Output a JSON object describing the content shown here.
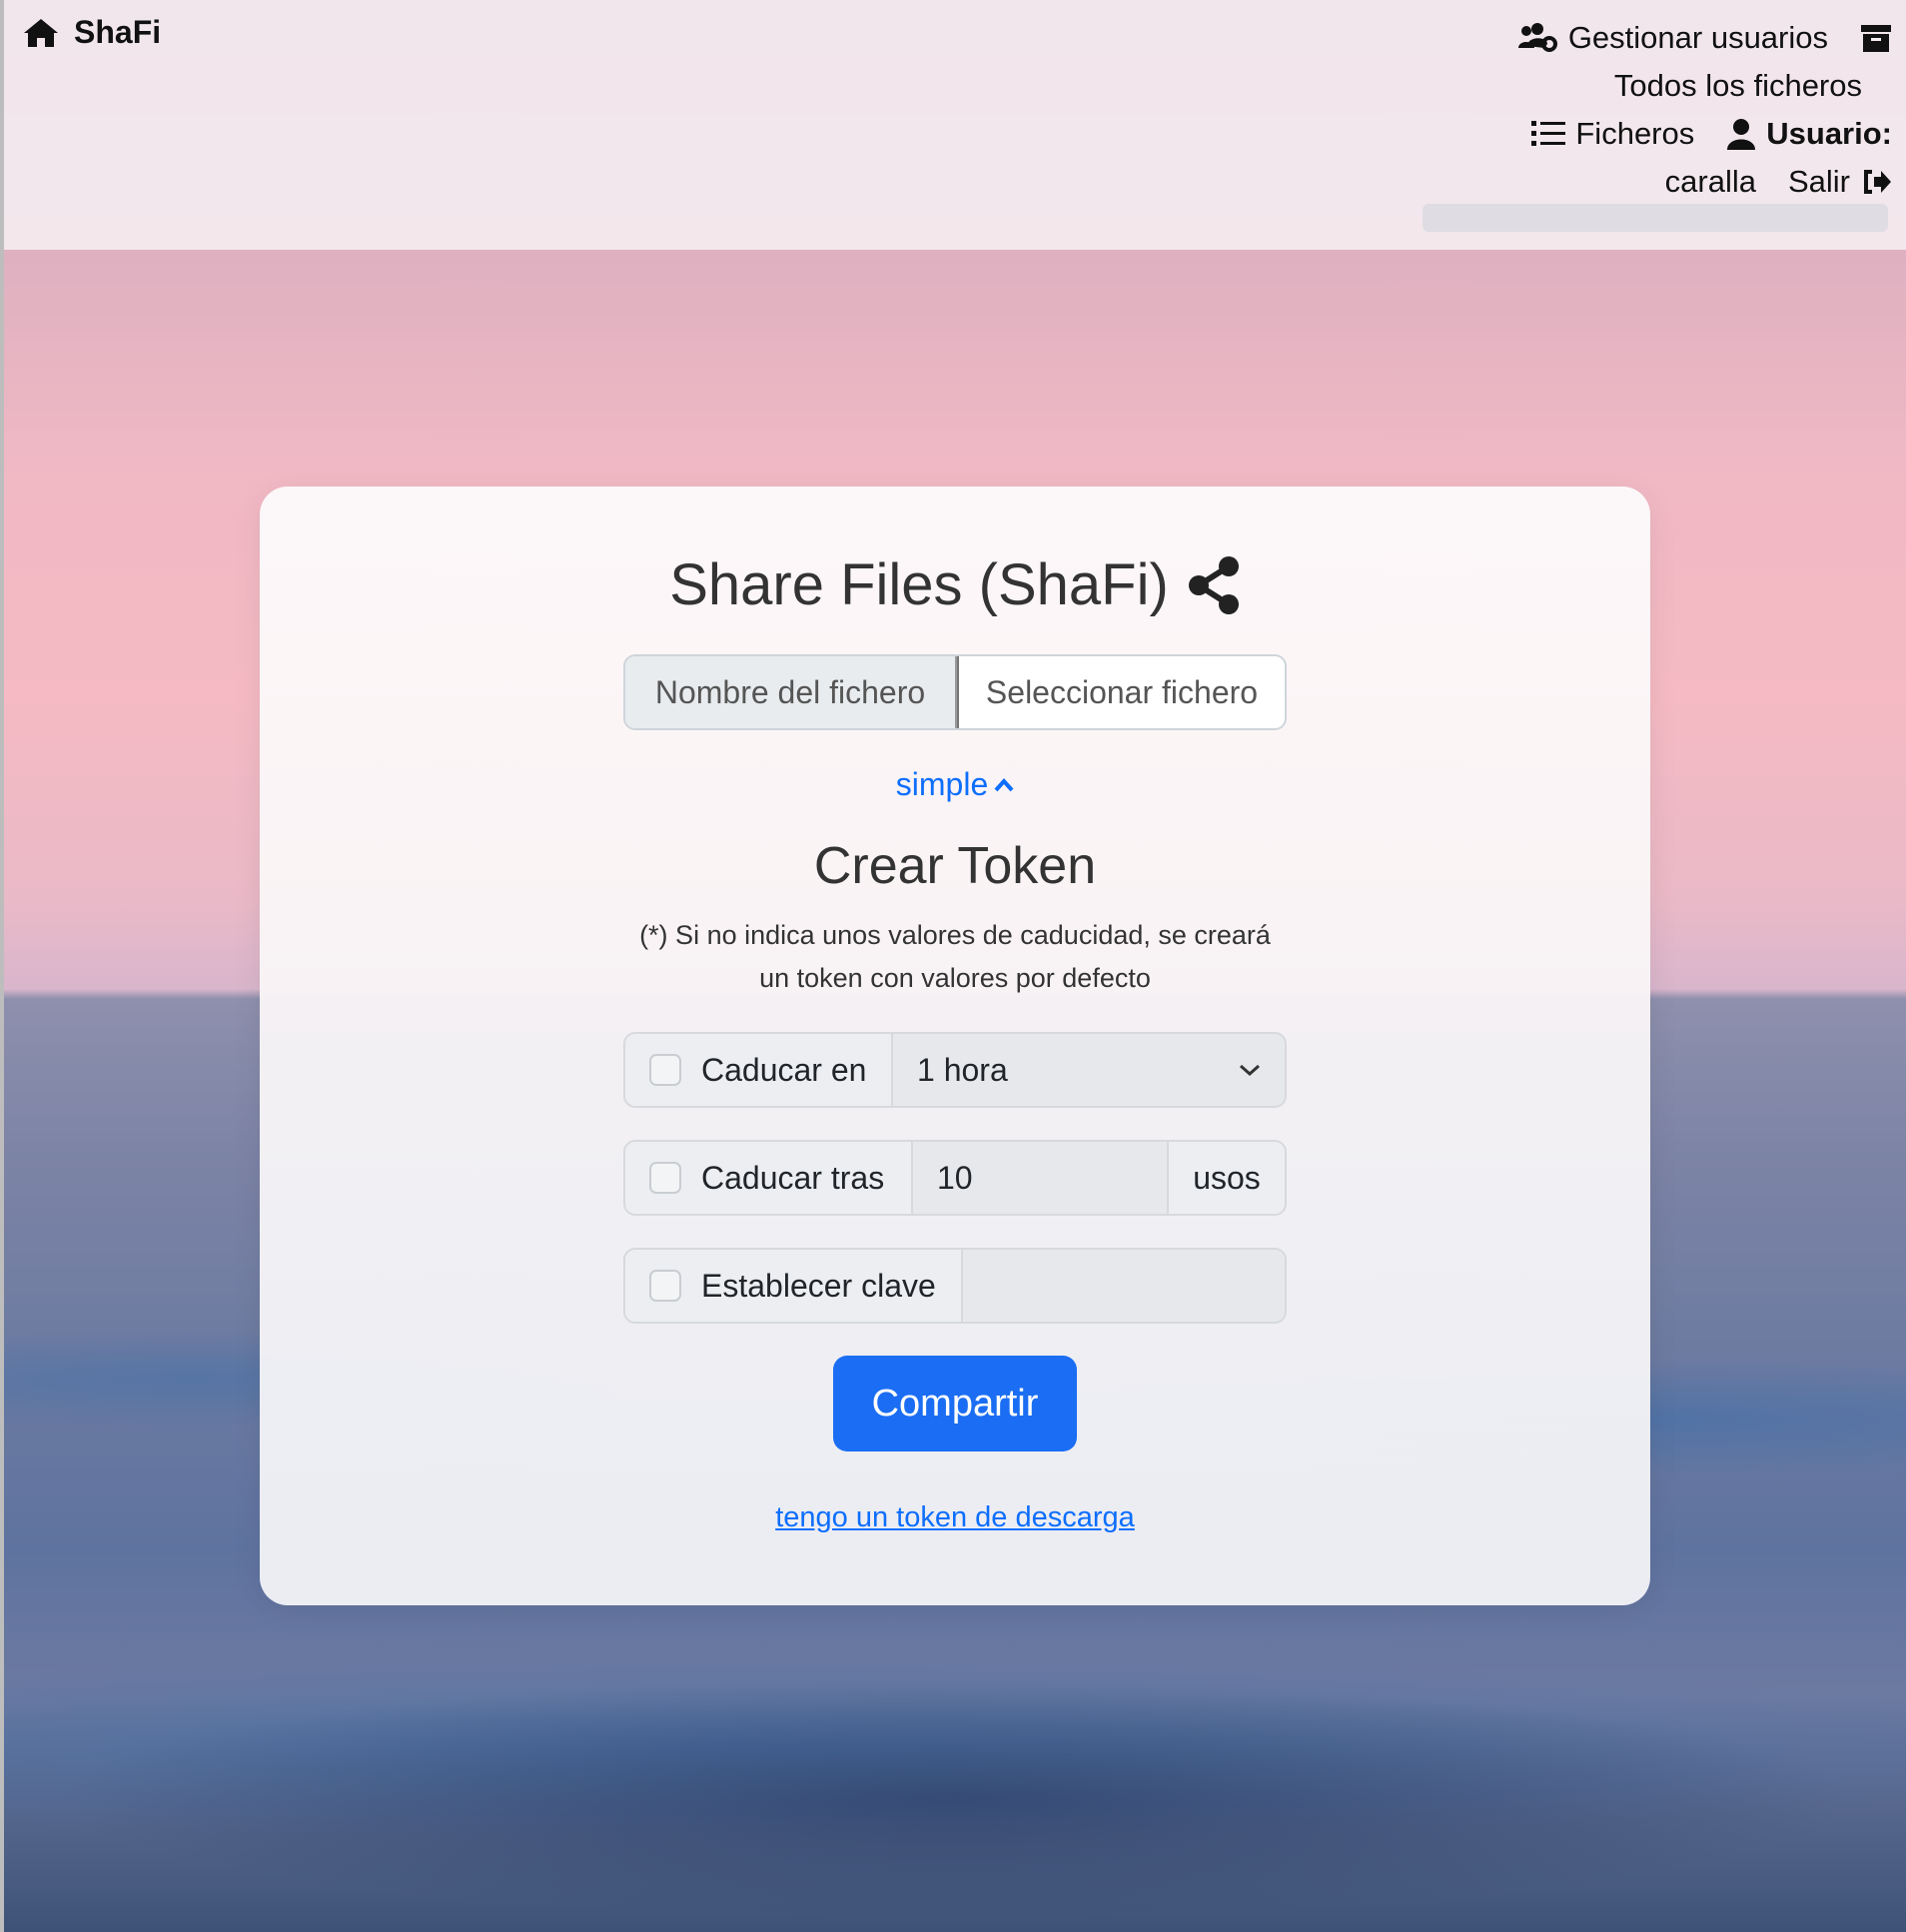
{
  "navbar": {
    "brand": "ShaFi",
    "manage_users": "Gestionar usuarios",
    "all_files": "Todos los ficheros",
    "files": "Ficheros",
    "user_label": "Usuario:",
    "username": "caralla",
    "logout": "Salir"
  },
  "card": {
    "title": "Share Files (ShaFi)",
    "file_name_label": "Nombre del fichero",
    "select_file_button": "Seleccionar fichero",
    "simple_link": "simple",
    "token_heading": "Crear Token",
    "note": "(*) Si no indica unos valores de caducidad, se creará un token con valores por defecto",
    "expire_in": {
      "label": "Caducar en",
      "value": "1 hora",
      "checked": false
    },
    "expire_after": {
      "label": "Caducar tras",
      "value": "10",
      "suffix": "usos",
      "checked": false
    },
    "set_password": {
      "label": "Establecer clave",
      "value": "",
      "checked": false
    },
    "share_button": "Compartir",
    "download_token_link": "tengo un token de descarga"
  },
  "colors": {
    "primary": "#1b6ef3",
    "link": "#0d6efd"
  }
}
